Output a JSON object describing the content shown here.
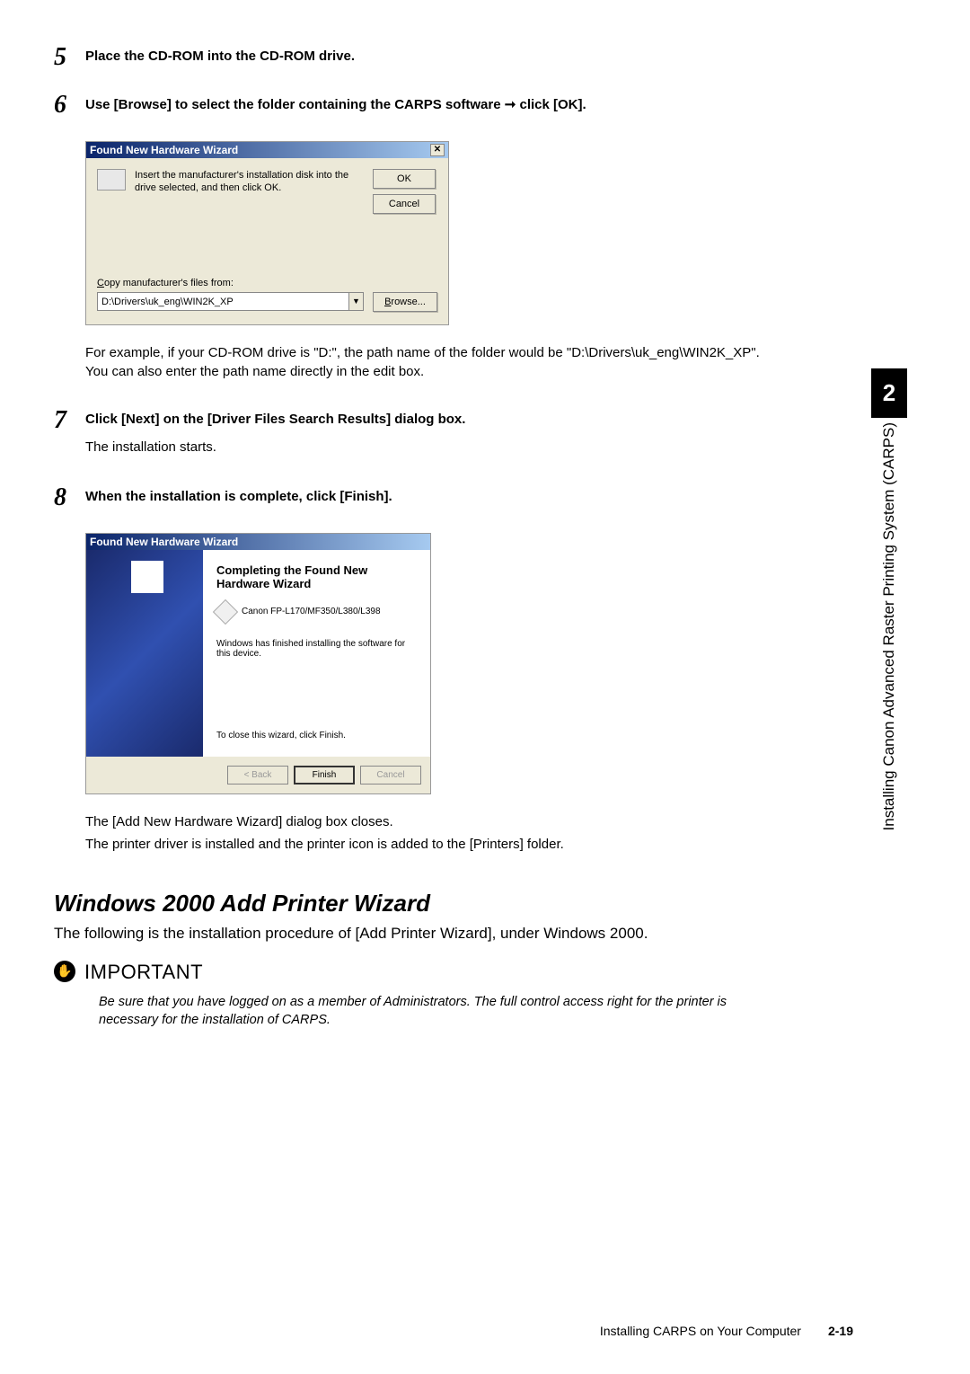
{
  "steps": {
    "5": {
      "num": "5",
      "title": "Place the CD-ROM into the CD-ROM drive."
    },
    "6": {
      "num": "6",
      "title": "Use [Browse] to select the folder containing the CARPS software ➞ click [OK].",
      "note": "For example, if your CD-ROM drive is \"D:\", the path name of the folder would be \"D:\\Drivers\\uk_eng\\WIN2K_XP\". You can also enter the path name directly in the edit box."
    },
    "7": {
      "num": "7",
      "title": "Click [Next] on the [Driver Files Search Results] dialog box.",
      "text": "The installation starts."
    },
    "8": {
      "num": "8",
      "title": "When the installation is complete, click [Finish].",
      "note1": "The [Add New Hardware Wizard] dialog box closes.",
      "note2": "The printer driver is installed and the printer icon is added to the [Printers] folder."
    }
  },
  "dialog1": {
    "title": "Found New Hardware Wizard",
    "instruction": "Insert the manufacturer's installation disk into the drive selected, and then click OK.",
    "ok": "OK",
    "cancel": "Cancel",
    "copy_label": "Copy manufacturer's files from:",
    "path": "D:\\Drivers\\uk_eng\\WIN2K_XP",
    "browse": "Browse..."
  },
  "dialog2": {
    "title": "Found New Hardware Wizard",
    "heading": "Completing the Found New Hardware Wizard",
    "printer": "Canon FP-L170/MF350/L380/L398",
    "message": "Windows has finished installing the software for this device.",
    "close_msg": "To close this wizard, click Finish.",
    "back": "< Back",
    "finish": "Finish",
    "cancel": "Cancel"
  },
  "section": {
    "heading": "Windows 2000 Add Printer Wizard",
    "intro": "The following is the installation procedure of [Add Printer Wizard], under Windows 2000."
  },
  "important": {
    "label": "IMPORTANT",
    "text": "Be sure that you have logged on as a member of Administrators. The full control access right for the printer is necessary for the installation of CARPS."
  },
  "sidetab": {
    "number": "2",
    "text": "Installing Canon Advanced Raster Printing System (CARPS)"
  },
  "footer": {
    "text": "Installing CARPS on Your Computer",
    "page": "2-19"
  }
}
